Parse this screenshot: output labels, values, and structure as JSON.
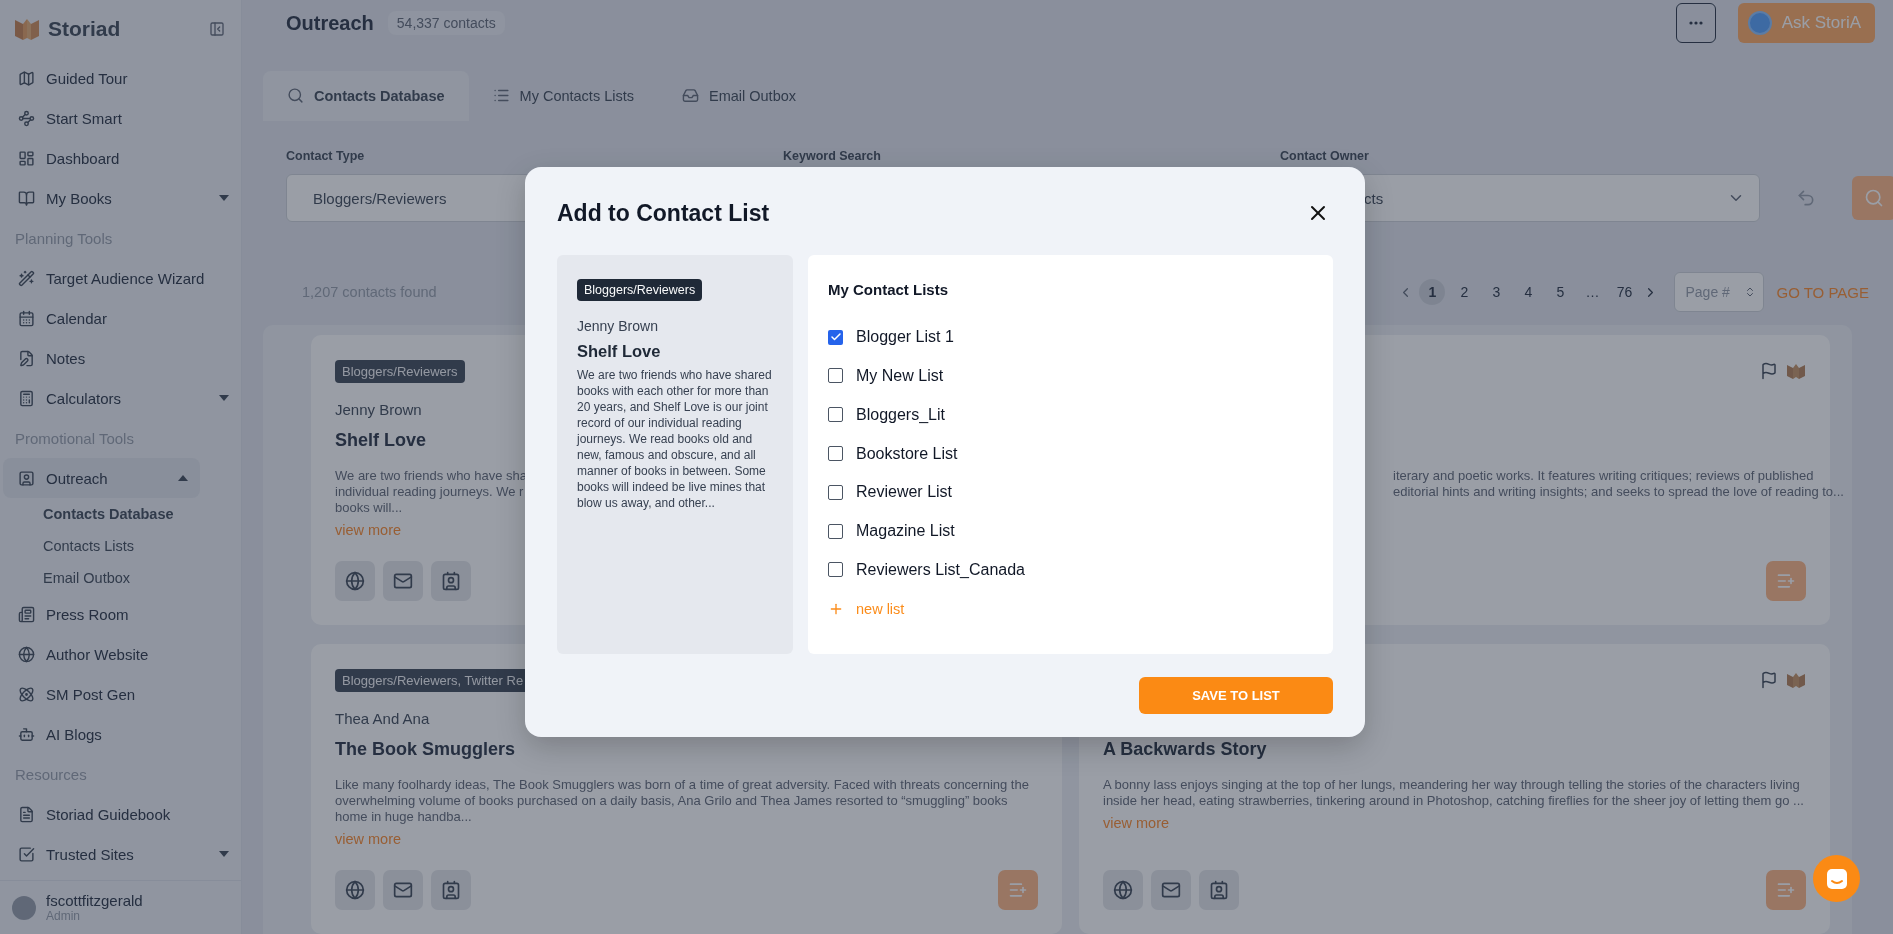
{
  "sidebar": {
    "brand": "Storiad",
    "items": [
      {
        "kind": "item",
        "label": "Guided Tour",
        "selected": false
      },
      {
        "kind": "item",
        "label": "Start Smart",
        "selected": false
      },
      {
        "kind": "item",
        "label": "Dashboard",
        "selected": false
      },
      {
        "kind": "item",
        "label": "My Books",
        "selected": false,
        "expanded": false
      },
      {
        "kind": "section",
        "label": "Planning Tools"
      },
      {
        "kind": "item",
        "label": "Target Audience Wizard",
        "selected": false
      },
      {
        "kind": "item",
        "label": "Calendar",
        "selected": false
      },
      {
        "kind": "item",
        "label": "Notes",
        "selected": false
      },
      {
        "kind": "item",
        "label": "Calculators",
        "selected": false,
        "expanded": false
      },
      {
        "kind": "section",
        "label": "Promotional Tools"
      },
      {
        "kind": "item",
        "label": "Outreach",
        "selected": true,
        "expanded": true,
        "children": [
          {
            "label": "Contacts Database",
            "selected": true
          },
          {
            "label": "Contacts Lists",
            "selected": false
          },
          {
            "label": "Email Outbox",
            "selected": false
          }
        ]
      },
      {
        "kind": "item",
        "label": "Press Room",
        "selected": false
      },
      {
        "kind": "item",
        "label": "Author Website",
        "selected": false
      },
      {
        "kind": "item",
        "label": "SM Post Gen",
        "selected": false
      },
      {
        "kind": "item",
        "label": "AI Blogs",
        "selected": false
      },
      {
        "kind": "section",
        "label": "Resources"
      },
      {
        "kind": "item",
        "label": "Storiad Guidebook",
        "selected": false
      },
      {
        "kind": "item",
        "label": "Trusted Sites",
        "selected": false,
        "expanded": false
      }
    ],
    "user": {
      "name": "fscottfitzgerald",
      "role": "Admin"
    }
  },
  "header": {
    "title": "Outreach",
    "count": "54,337 contacts",
    "assistant_button": "Ask StoriA"
  },
  "tabs": [
    {
      "label": "Contacts Database",
      "selected": true
    },
    {
      "label": "My Contacts Lists",
      "selected": false
    },
    {
      "label": "Email Outbox",
      "selected": false
    }
  ],
  "filters": [
    {
      "label": "Contact Type",
      "value": "Bloggers/Reviewers"
    },
    {
      "label": "Keyword Search"
    },
    {
      "label": "Contact Owner",
      "value": "cts"
    }
  ],
  "results": {
    "count": "1,207 contacts found",
    "pages": [
      {
        "label": "1",
        "selected": true
      },
      {
        "label": "2",
        "selected": false
      },
      {
        "label": "3",
        "selected": false
      },
      {
        "label": "4",
        "selected": false
      },
      {
        "label": "5",
        "selected": false
      },
      {
        "label": "…",
        "selected": false
      },
      {
        "label": "76",
        "selected": false
      }
    ],
    "page_input": {
      "placeholder": "Page #"
    },
    "go_button": "GO TO PAGE"
  },
  "cards": [
    {
      "tag": "Bloggers/Reviewers",
      "name": "Jenny Brown",
      "title": "Shelf Love",
      "visible_lines": [
        "We are two friends who have sha",
        "individual reading journeys. We r",
        "books will..."
      ],
      "link": "view more",
      "flag_icons": false,
      "contact_icons": true,
      "add_button": false
    },
    {
      "visible_lines": [
        "iterary and poetic works. It features writing critiques; reviews of published",
        "editorial hints and writing insights; and seeks to spread the love of reading to..."
      ],
      "flag_icons": true,
      "contact_icons": false,
      "add_button": true
    },
    {
      "tag": "Bloggers/Reviewers, Twitter Re",
      "name": "Thea And Ana",
      "title": "The Book Smugglers",
      "description": "Like many foolhardy ideas, The Book Smugglers was born of a time of great adversity. Faced with threats concerning the overwhelming volume of books purchased on a daily basis, Ana Grilo and Thea James resorted to “smuggling” books home in huge handba...",
      "link": "view more",
      "flag_icons": false,
      "contact_icons": true,
      "add_button": true
    },
    {
      "title": "A Backwards Story",
      "description": "A bonny lass enjoys singing at the top of her lungs, meandering her way through telling the stories of the characters living inside her head, eating strawberries, tinkering around in Photoshop, catching fireflies for the sheer joy of letting them go ...",
      "link": "view more",
      "flag_icons": true,
      "contact_icons": true,
      "add_button": true
    }
  ],
  "modal": {
    "title": "Add to Contact List",
    "contact": {
      "tag": "Bloggers/Reviewers",
      "name": "Jenny Brown",
      "title": "Shelf Love",
      "description": "We are two friends who have shared books with each other for more than 20 years, and Shelf Love is our joint record of our individual reading journeys. We read books old and new, famous and obscure, and all manner of books in between. Some books will indeed be live mines that blow us away, and other..."
    },
    "lists_heading": "My Contact Lists",
    "lists": [
      {
        "label": "Blogger List 1",
        "checked": true
      },
      {
        "label": "My New List",
        "checked": false
      },
      {
        "label": "Bloggers_Lit",
        "checked": false
      },
      {
        "label": "Bookstore List",
        "checked": false
      },
      {
        "label": "Reviewer List",
        "checked": false
      },
      {
        "label": "Magazine List",
        "checked": false
      },
      {
        "label": "Reviewers List_Canada",
        "checked": false
      }
    ],
    "new_list": "new list",
    "save_button": "SAVE TO LIST"
  }
}
